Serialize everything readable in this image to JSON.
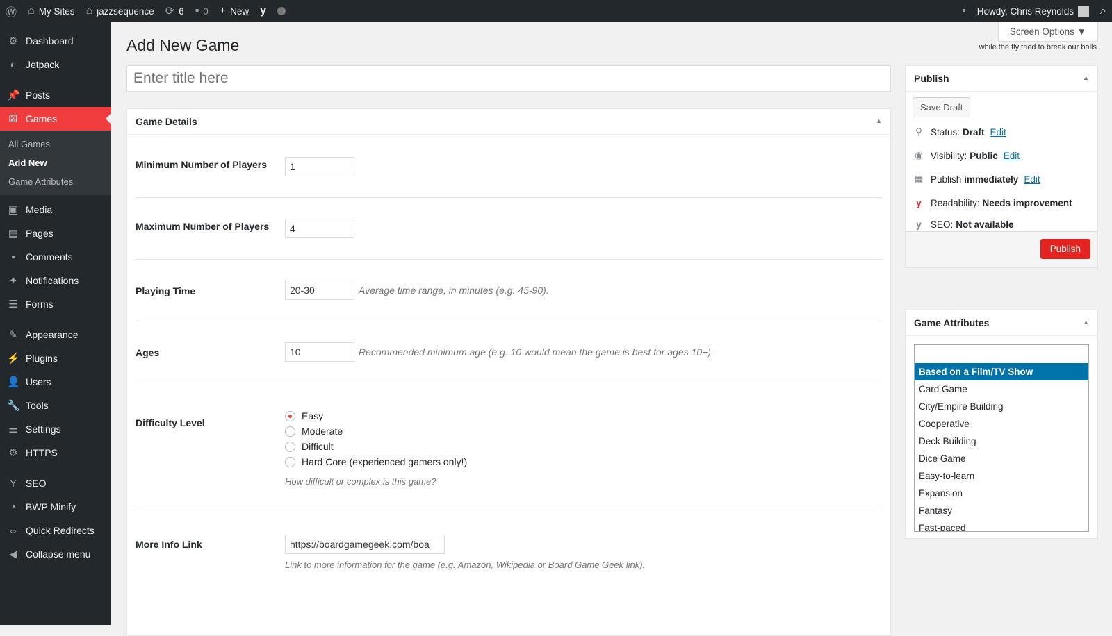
{
  "adminbar": {
    "my_sites": "My Sites",
    "site": "jazzsequence",
    "updates": "6",
    "comments": "0",
    "new": "New",
    "howdy": "Howdy, Chris Reynolds"
  },
  "menu": {
    "items": [
      {
        "label": "Dashboard",
        "icon": "dashboard-icon",
        "g": "⚙"
      },
      {
        "label": "Jetpack",
        "icon": "jetpack-icon",
        "g": "◐"
      },
      {
        "label": "Posts",
        "icon": "pin-icon",
        "g": "📌"
      },
      {
        "label": "Games",
        "icon": "dice-icon",
        "g": "⚄"
      }
    ],
    "sub": [
      "All Games",
      "Add New",
      "Game Attributes"
    ],
    "items2": [
      {
        "label": "Media",
        "icon": "media-icon",
        "g": "▣"
      },
      {
        "label": "Pages",
        "icon": "pages-icon",
        "g": "▤"
      },
      {
        "label": "Comments",
        "icon": "comment-icon",
        "g": "▪"
      },
      {
        "label": "Notifications",
        "icon": "notifications-icon",
        "g": "✦"
      },
      {
        "label": "Forms",
        "icon": "forms-icon",
        "g": "☰"
      },
      {
        "label": "Appearance",
        "icon": "brush-icon",
        "g": "✎"
      },
      {
        "label": "Plugins",
        "icon": "plugin-icon",
        "g": "⚡"
      },
      {
        "label": "Users",
        "icon": "user-icon",
        "g": "👤"
      },
      {
        "label": "Tools",
        "icon": "wrench-icon",
        "g": "🔧"
      },
      {
        "label": "Settings",
        "icon": "settings-icon",
        "g": "⚌"
      },
      {
        "label": "HTTPS",
        "icon": "gear-icon",
        "g": "⚙"
      },
      {
        "label": "SEO",
        "icon": "yoast-icon",
        "g": "Y"
      },
      {
        "label": "BWP Minify",
        "icon": "dashboard-icon",
        "g": "◔"
      },
      {
        "label": "Quick Redirects",
        "icon": "redirect-icon",
        "g": "⇔"
      },
      {
        "label": "Collapse menu",
        "icon": "collapse-icon",
        "g": "◀"
      }
    ]
  },
  "page": {
    "title": "Add New Game",
    "screen_options": "Screen Options ▼",
    "tagline": "while the fly tried to break our balls",
    "title_placeholder": "Enter title here"
  },
  "details": {
    "heading": "Game Details",
    "min_label": "Minimum Number of Players",
    "min_value": "1",
    "max_label": "Maximum Number of Players",
    "max_value": "4",
    "time_label": "Playing Time",
    "time_value": "20-30",
    "time_desc": "Average time range, in minutes (e.g. 45-90).",
    "ages_label": "Ages",
    "ages_value": "10",
    "ages_desc": "Recommended minimum age (e.g. 10 would mean the game is best for ages 10+).",
    "diff_label": "Difficulty Level",
    "diff_options": [
      "Easy",
      "Moderate",
      "Difficult",
      "Hard Core (experienced gamers only!)"
    ],
    "diff_selected": "Easy",
    "diff_desc": "How difficult or complex is this game?",
    "link_label": "More Info Link",
    "link_value": "https://boardgamegeek.com/boa",
    "link_desc": "Link to more information for the game (e.g. Amazon, Wikipedia or Board Game Geek link)."
  },
  "publish": {
    "heading": "Publish",
    "save_draft": "Save Draft",
    "status_label": "Status:",
    "status": "Draft",
    "visibility_label": "Visibility:",
    "visibility": "Public",
    "publish_label": "Publish",
    "publish_when": "immediately",
    "edit": "Edit",
    "readability_label": "Readability:",
    "readability": "Needs improvement",
    "seo_label": "SEO:",
    "seo": "Not available",
    "publish_button": "Publish"
  },
  "attributes": {
    "heading": "Game Attributes",
    "options": [
      "Based on a Film/TV Show",
      "Card Game",
      "City/Empire Building",
      "Cooperative",
      "Deck Building",
      "Dice Game",
      "Easy-to-learn",
      "Expansion",
      "Fantasy",
      "Fast-paced"
    ]
  },
  "colors": {
    "accent": "#f03c3c",
    "link": "#0073aa",
    "highlight": "#0073aa"
  }
}
